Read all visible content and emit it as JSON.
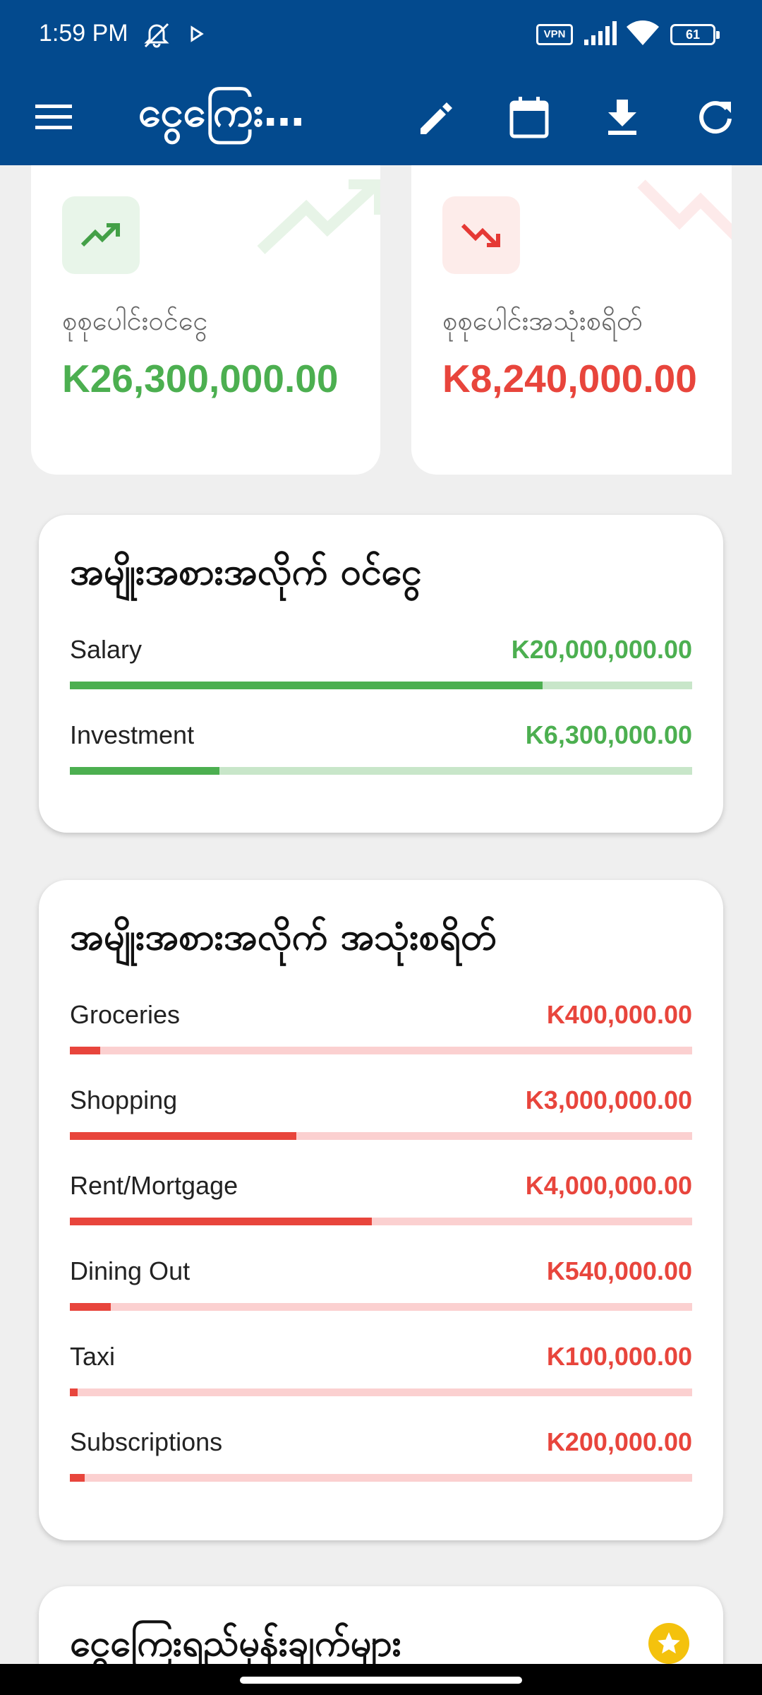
{
  "status_bar": {
    "time": "1:59 PM",
    "vpn": "VPN",
    "battery": "61"
  },
  "app_bar": {
    "title": "ငွေကြေး…",
    "icons": [
      "menu-icon",
      "edit-icon",
      "calendar-icon",
      "download-icon",
      "refresh-icon"
    ]
  },
  "summary": {
    "income": {
      "label": "စုစုပေါင်းဝင်ငွေ",
      "amount": "K26,300,000.00",
      "color": "#4caf50"
    },
    "expense": {
      "label": "စုစုပေါင်းအသုံးစရိတ်",
      "amount": "K8,240,000.00",
      "color": "#e8453c"
    }
  },
  "income_by_category": {
    "title": "အမျိုးအစားအလိုက် ဝင်ငွေ",
    "color": "#4caf50",
    "track_color": "#c8e6c9",
    "items": [
      {
        "name": "Salary",
        "amount": "K20,000,000.00",
        "share": 0.76
      },
      {
        "name": "Investment",
        "amount": "K6,300,000.00",
        "share": 0.24
      }
    ]
  },
  "expense_by_category": {
    "title": "အမျိုးအစားအလိုက် အသုံးစရိတ်",
    "color": "#e8453c",
    "track_color": "#fbd0d0",
    "items": [
      {
        "name": "Groceries",
        "amount": "K400,000.00",
        "share": 0.049
      },
      {
        "name": "Shopping",
        "amount": "K3,000,000.00",
        "share": 0.364
      },
      {
        "name": "Rent/Mortgage",
        "amount": "K4,000,000.00",
        "share": 0.485
      },
      {
        "name": "Dining Out",
        "amount": "K540,000.00",
        "share": 0.066
      },
      {
        "name": "Taxi",
        "amount": "K100,000.00",
        "share": 0.012
      },
      {
        "name": "Subscriptions",
        "amount": "K200,000.00",
        "share": 0.024
      }
    ]
  },
  "insights": {
    "title": "ငွေကြေးရည်မှန်းချက်များ",
    "icon": "star-icon"
  }
}
